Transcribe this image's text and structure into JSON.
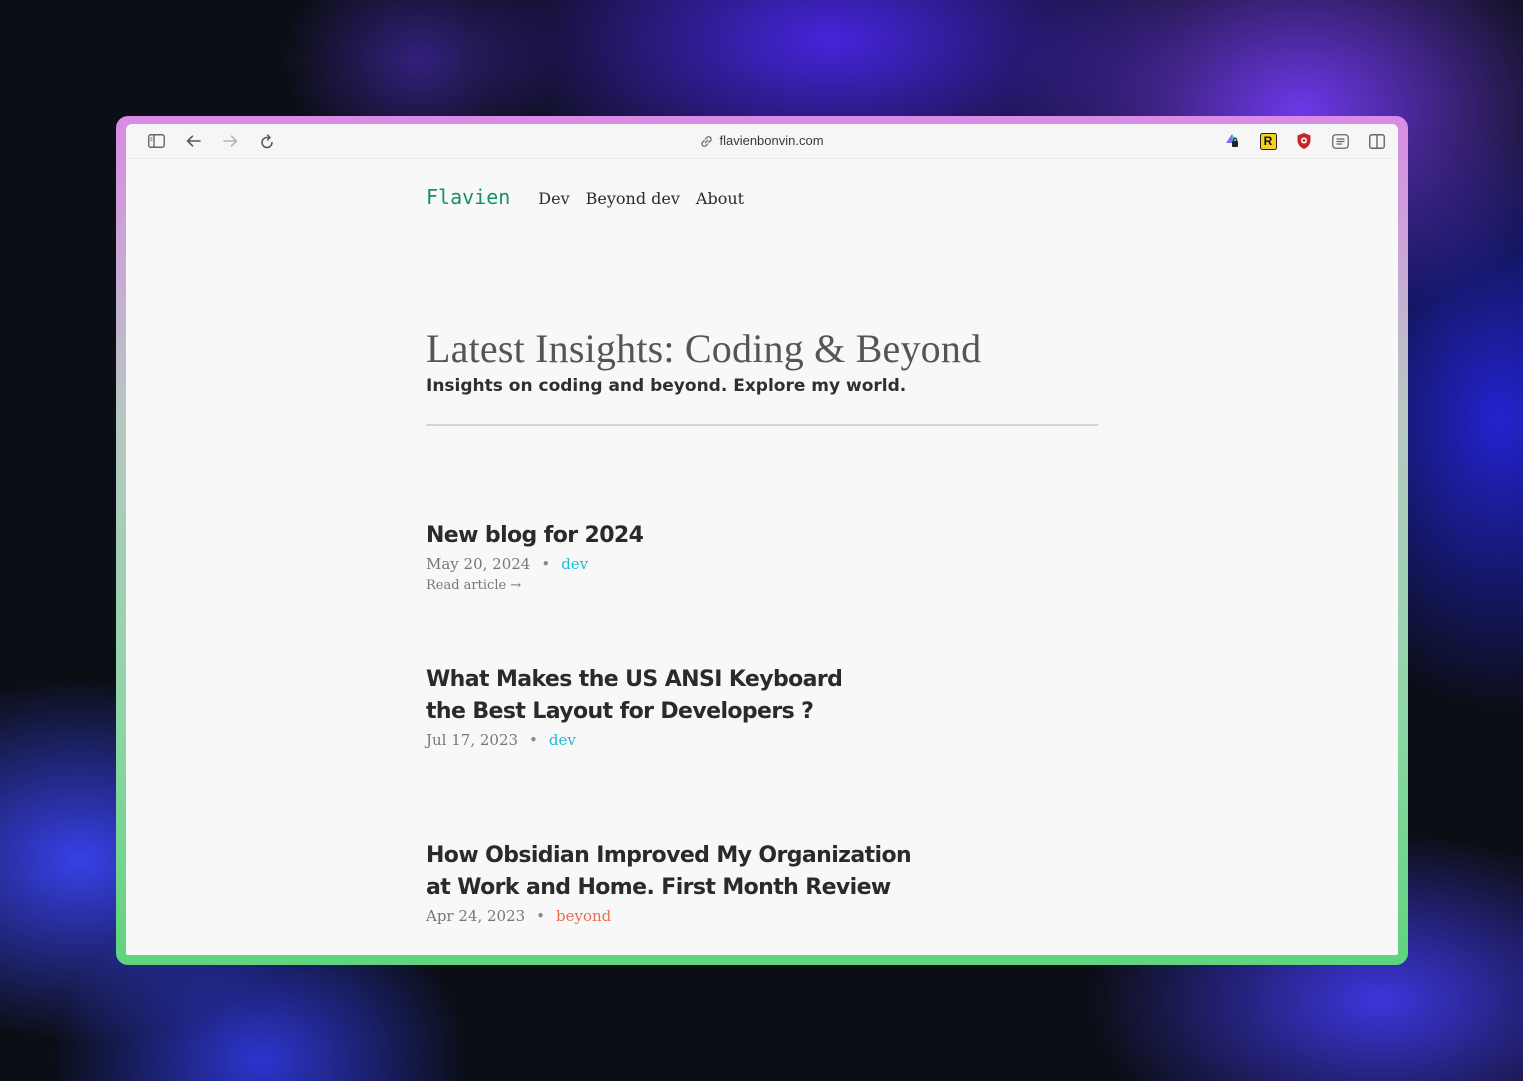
{
  "browser": {
    "url": "flavienbonvin.com",
    "icons": [
      "sidebar-icon",
      "back-arrow-icon",
      "forward-arrow-icon",
      "reload-icon",
      "link-icon",
      "extension-lock-icon",
      "extension-r-icon",
      "extension-shield-icon",
      "reader-icon",
      "split-view-icon"
    ],
    "extension_r_letter": "R"
  },
  "site": {
    "brand": "Flavien",
    "nav": [
      {
        "label": "Dev"
      },
      {
        "label": "Beyond dev"
      },
      {
        "label": "About"
      }
    ]
  },
  "hero": {
    "title": "Latest Insights: Coding & Beyond",
    "subtitle": "Insights on coding and beyond. Explore my world."
  },
  "posts": [
    {
      "title_line1": "New blog for 2024",
      "title_line2": "",
      "date": "May 20, 2024",
      "separator": "•",
      "tag": "dev",
      "read_more": "Read article →"
    },
    {
      "title_line1": "What Makes the US ANSI Keyboard",
      "title_line2": "the Best Layout for Developers ?",
      "date": "Jul 17, 2023",
      "separator": "•",
      "tag": "dev"
    },
    {
      "title_line1": "How Obsidian Improved My Organization",
      "title_line2": "at Work and Home. First Month Review",
      "date": "Apr 24, 2023",
      "separator": "•",
      "tag": "beyond"
    }
  ],
  "colors": {
    "brand": "#1a8f6a",
    "tag_dev": "#1fb8d8",
    "tag_beyond": "#ee6b4d",
    "frame_top": "#d98be6",
    "frame_bottom": "#5fd47e"
  }
}
